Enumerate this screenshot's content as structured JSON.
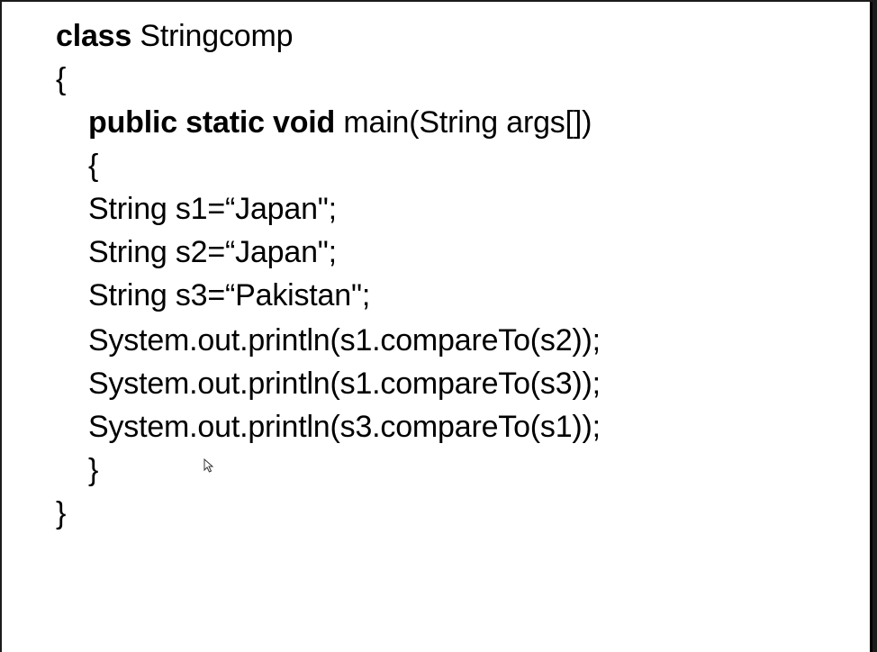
{
  "code": {
    "class_keyword": "class",
    "class_name": " Stringcomp",
    "open_class": "{",
    "method_modifiers": "public static void",
    "method_signature": " main(String args[])",
    "open_method": "{",
    "line_s1": "String s1=“Japan\";",
    "line_s2": "String s2=“Japan\";",
    "line_s3": "String s3=“Pakistan\";",
    "line_print1": "System.out.println(s1.compareTo(s2));",
    "line_print2": "System.out.println(s1.compareTo(s3));",
    "line_print3": "System.out.println(s3.compareTo(s1));",
    "close_method": "}",
    "close_class": "}"
  },
  "cursor_icon": "mouse-pointer-icon",
  "colors": {
    "background": "#ffffff",
    "text": "#000000",
    "frame": "#1b1b1b"
  }
}
